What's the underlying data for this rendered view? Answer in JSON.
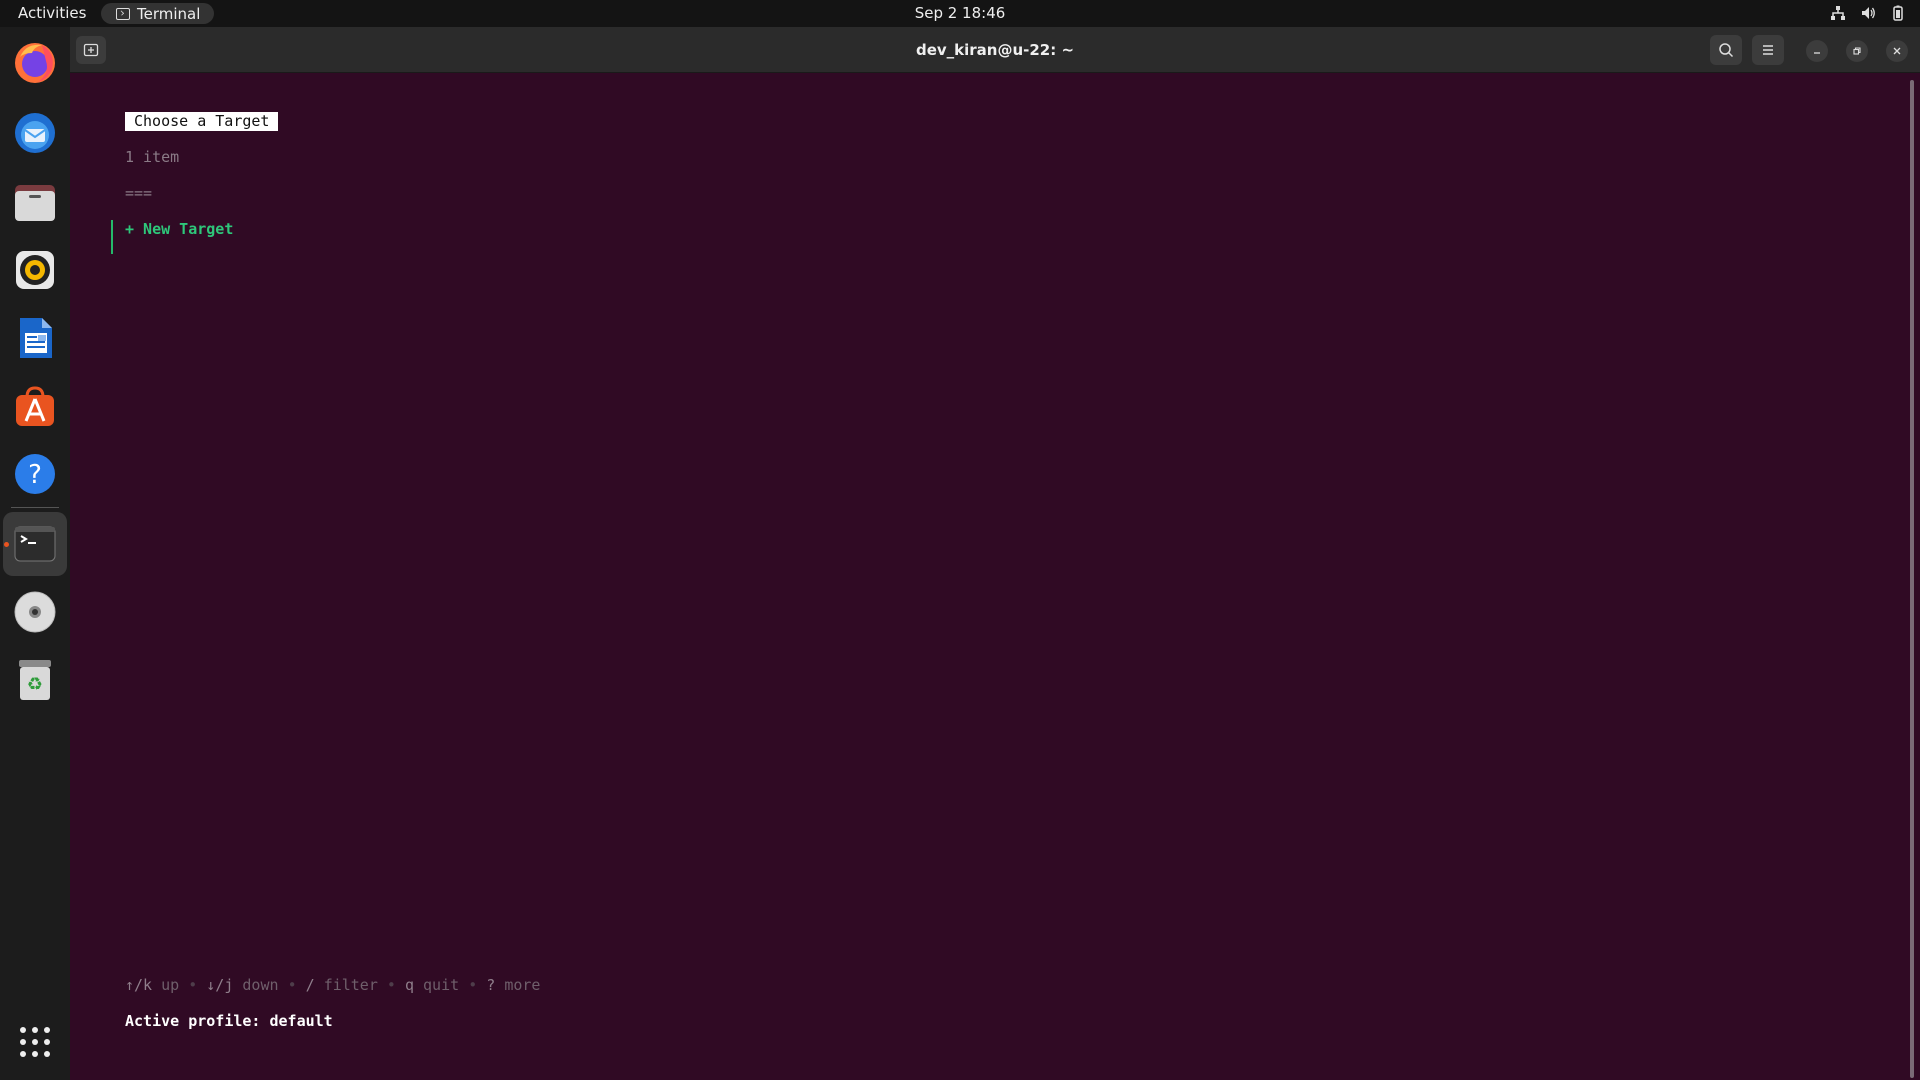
{
  "topbar": {
    "activities_label": "Activities",
    "app_name": "Terminal",
    "clock": "Sep 2  18:46",
    "icons": [
      "network-icon",
      "volume-icon",
      "battery-icon"
    ]
  },
  "dock": {
    "items": [
      {
        "name": "firefox",
        "icon": "firefox-icon"
      },
      {
        "name": "thunderbird",
        "icon": "thunderbird-icon"
      },
      {
        "name": "files",
        "icon": "files-icon"
      },
      {
        "name": "rhythmbox",
        "icon": "rhythmbox-icon"
      },
      {
        "name": "writer",
        "icon": "writer-icon"
      },
      {
        "name": "app-center",
        "icon": "app-center-icon"
      },
      {
        "name": "help",
        "icon": "help-icon"
      },
      {
        "name": "terminal",
        "icon": "terminal-icon",
        "active": true
      },
      {
        "name": "disc",
        "icon": "disc-icon"
      },
      {
        "name": "trash",
        "icon": "trash-icon"
      },
      {
        "name": "show-apps",
        "icon": "apps-grid-icon"
      }
    ]
  },
  "window": {
    "title": "dev_kiran@u-22: ~"
  },
  "terminal": {
    "list_title": "Choose a Target",
    "item_count": "1 item",
    "divider": "===",
    "items": [
      "+ New Target"
    ],
    "help": {
      "up_key": "↑/k",
      "up_label": "up",
      "down_key": "↓/j",
      "down_label": "down",
      "filter_key": "/",
      "filter_label": "filter",
      "quit_key": "q",
      "quit_label": "quit",
      "more_key": "?",
      "more_label": "more",
      "separator": "•"
    },
    "active_profile": "Active profile: default"
  },
  "colors": {
    "terminal_bg": "#300a24",
    "accent_green": "#2ec77a",
    "ubuntu_orange": "#e95420"
  }
}
